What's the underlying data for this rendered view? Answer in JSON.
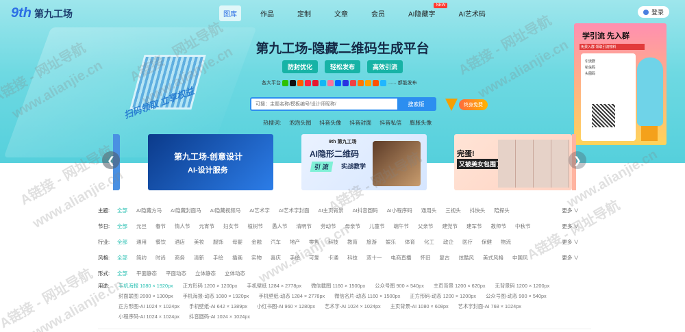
{
  "colors": {
    "accent": "#2c8ef0",
    "teal": "#17b3a6",
    "filter_active": "#2ac0b3"
  },
  "header": {
    "logo_mark": "9th",
    "logo_text": "第九工场",
    "nav": [
      {
        "label": "图库"
      },
      {
        "label": "作品"
      },
      {
        "label": "定制"
      },
      {
        "label": "文章"
      },
      {
        "label": "会员"
      },
      {
        "label": "AI隐藏字",
        "badge": "NEW"
      },
      {
        "label": "AI艺术码"
      }
    ],
    "login": "登录"
  },
  "hero": {
    "slogan": "扫码领取 立享权益",
    "headline": "第九工场-隐藏二维码生成平台",
    "tags": [
      "防封优化",
      "轻松发布",
      "高效引流"
    ],
    "platforms_label": "各大平台",
    "platforms_suffix": "...... 都能发布",
    "platform_icons": [
      "wechat-icon",
      "tiktok-icon",
      "kuaishou-icon",
      "xiaohongshu-icon",
      "weibo-icon",
      "qq-icon",
      "bilibili-icon",
      "zhihu-icon",
      "baidu-icon",
      "toutiao-icon",
      "douyu-icon",
      "huya-icon",
      "taobao-icon",
      "youku-icon"
    ],
    "search_placeholder": "可搜：主题名称/模板编号/设计师昵称/",
    "search_button": "搜索版",
    "vip_button": "终身免费",
    "hot_label": "热搜词:",
    "hot_words": [
      "泡泡头图",
      "抖音头像",
      "抖音封面",
      "抖音私信",
      "膨胀头像"
    ]
  },
  "promo": {
    "title": "学引流 先入群",
    "subtitle": "免费入群 领取引流物料",
    "card_items": [
      "引流群",
      "私信码",
      "头图码"
    ]
  },
  "banners": [
    {
      "title": "第九工场-创意设计",
      "subtitle": "AI-设计服务"
    },
    {
      "brand": "9th 第九工场",
      "title": "AI隐形二维码",
      "tag": "引 流",
      "tag2": "实战教学"
    },
    {
      "title": "完蛋!",
      "subtitle": "又被美女包围了"
    }
  ],
  "filters": [
    {
      "label": "主题:",
      "options": [
        "全部",
        "AI隐藏方马",
        "AI隐藏封面马",
        "AI隐藏视频马",
        "AI艺术字",
        "AI艺术字封面",
        "AI主页背景",
        "AI抖音圆码",
        "AI小程序码",
        "通用头",
        "三视头",
        "抖快头",
        "陪探头"
      ],
      "more": "更多"
    },
    {
      "label": "节日:",
      "options": [
        "全部",
        "元旦",
        "春节",
        "情人节",
        "元宵节",
        "妇女节",
        "植树节",
        "愚人节",
        "清明节",
        "劳动节",
        "母亲节",
        "儿童节",
        "端午节",
        "父亲节",
        "建党节",
        "建军节",
        "教师节",
        "中秋节"
      ],
      "more": "更多"
    },
    {
      "label": "行业:",
      "options": [
        "全部",
        "通用",
        "餐饮",
        "酒店",
        "美妆",
        "服饰",
        "母婴",
        "金融",
        "汽车",
        "地产",
        "零售",
        "科技",
        "教育",
        "旅游",
        "娱乐",
        "体育",
        "化工",
        "政企",
        "医疗",
        "保健",
        "物流"
      ],
      "more": "更多"
    },
    {
      "label": "风格:",
      "options": [
        "全部",
        "简约",
        "时尚",
        "商务",
        "清新",
        "手绘",
        "插画",
        "实物",
        "喜庆",
        "手绘",
        "可爱",
        "卡通",
        "科技",
        "双十一",
        "电商直播",
        "怀旧",
        "复古",
        "炫酷风",
        "美式风格",
        "中国风"
      ],
      "more": "更多"
    },
    {
      "label": "形式:",
      "options": [
        "全部",
        "平面静态",
        "平面动态",
        "立体静态",
        "立体动态"
      ],
      "more": ""
    }
  ],
  "usage": {
    "label": "用途:",
    "items": [
      "手机海报 1080 × 1920px",
      "正方形码 1200 × 1200px",
      "手机壁纸 1284 × 2778px",
      "微信截图 1160 × 1500px",
      "公众号图 900 × 540px",
      "主页背景 1200 × 620px",
      "无背景码 1200 × 1200px",
      "封面联图 2000 × 1300px",
      "手机海报-动态 1080 × 1920px",
      "手机壁纸-动态 1284 × 2778px",
      "微信名片-动态 1160 × 1500px",
      "正方形码-动态 1200 × 1200px",
      "公众号图-动态 900 × 540px",
      "正方形图-AI 1024 × 1024px",
      "手机壁纸-AI 642 × 1389px",
      "小红书图-AI 960 × 1280px",
      "艺术字-AI 1024 × 1024px",
      "主页背景-AI 1080 × 608px",
      "艺术字封面-AI 768 × 1024px",
      "小程序码-AI 1024 × 1024px",
      "抖音圆码-AI 1024 × 1024px"
    ]
  },
  "watermark": {
    "text1": "A链接 - 网址导航",
    "text2": "www.alianjie.cn"
  }
}
